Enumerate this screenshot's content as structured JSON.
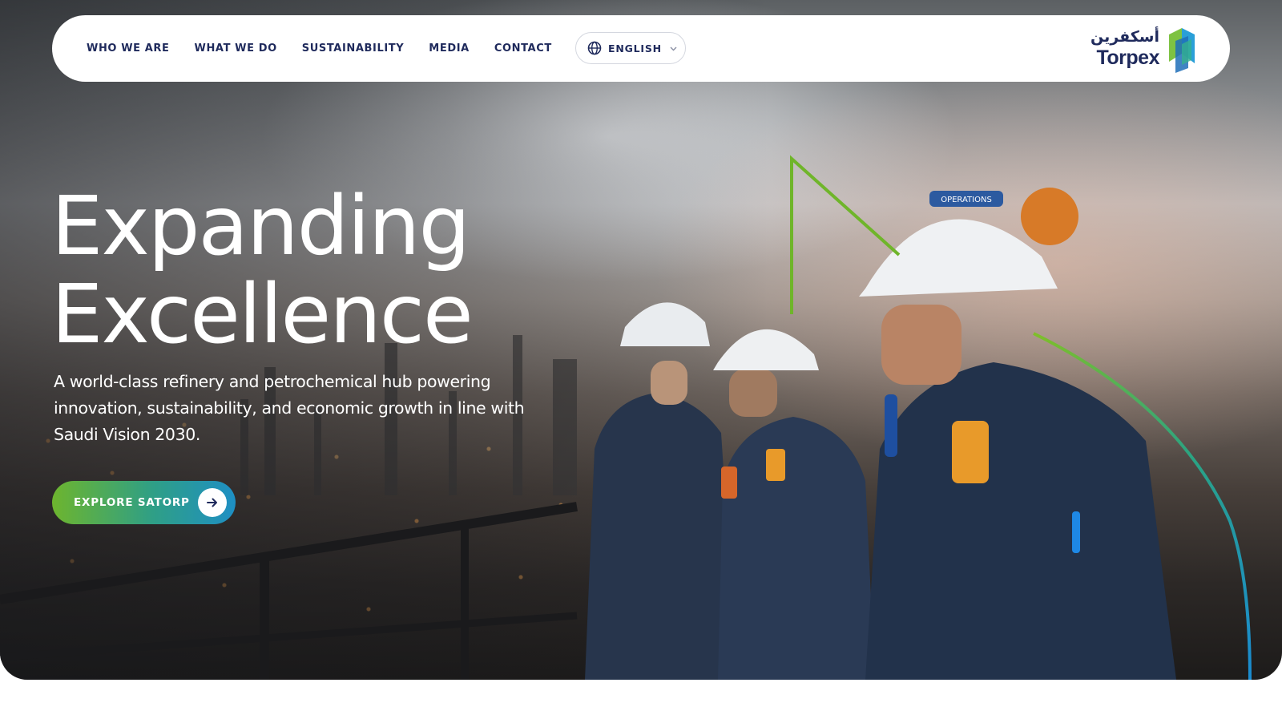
{
  "nav": {
    "links": [
      {
        "label": "WHO WE ARE"
      },
      {
        "label": "WHAT WE DO"
      },
      {
        "label": "SUSTAINABILITY"
      },
      {
        "label": "MEDIA"
      },
      {
        "label": "CONTACT"
      }
    ],
    "language": {
      "selected": "ENGLISH",
      "icon": "globe-icon",
      "chevron": "chevron-down-icon"
    }
  },
  "brand": {
    "name_arabic": "أسكفرين",
    "name": "Torpex"
  },
  "hero": {
    "headline_line1": "Expanding",
    "headline_line2": "Excellence",
    "description": "A world-class refinery and petrochemical hub powering innovation, sustainability, and economic growth in line with Saudi Vision 2030.",
    "cta_label": "EXPLORE SATORP",
    "cta_icon": "arrow-right-icon",
    "helmet_label": "OPERATIONS"
  },
  "colors": {
    "navy": "#1f2a5c",
    "green": "#6db52e",
    "teal": "#2f9f86",
    "blue": "#1e8fc4"
  }
}
